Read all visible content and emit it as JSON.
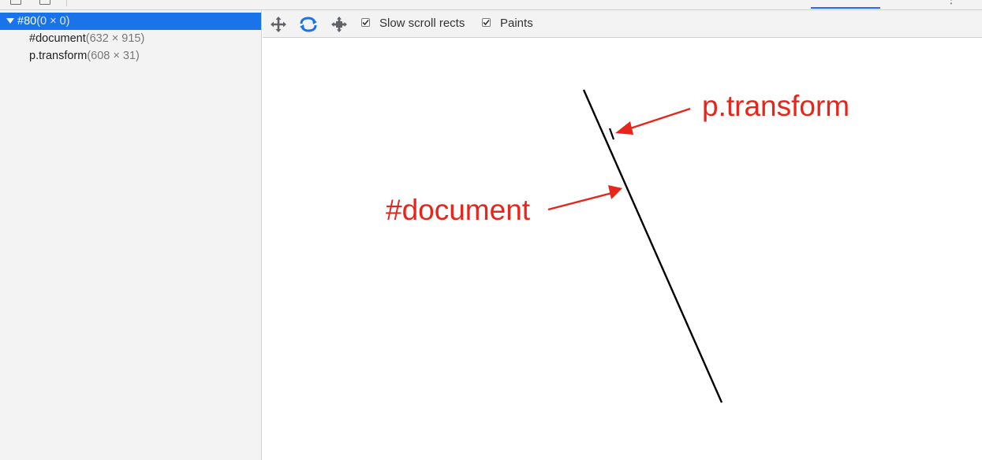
{
  "layer_tree": [
    {
      "name": "#80",
      "dims": "(0 × 0)",
      "selected": true
    },
    {
      "name": "#document",
      "dims": "(632 × 915)",
      "selected": false
    },
    {
      "name": "p.transform",
      "dims": "(608 × 31)",
      "selected": false
    }
  ],
  "toolbar": {
    "pan_icon": "pan-mode-icon",
    "rotate_icon": "rotate-mode-icon",
    "reset_icon": "reset-transform-icon",
    "slow_scroll_label": "Slow scroll rects",
    "slow_scroll_checked": true,
    "paints_label": "Paints",
    "paints_checked": true
  },
  "annotations": {
    "p_transform": "p.transform",
    "document": "#document"
  },
  "colors": {
    "selection": "#1a73e8",
    "annotation": "#e8251b",
    "panel_bg": "#f3f3f3"
  }
}
